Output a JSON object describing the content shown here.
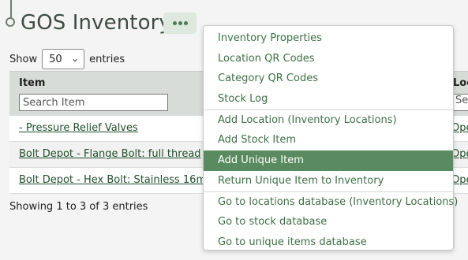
{
  "header": {
    "title": "GOS Inventory"
  },
  "length_control": {
    "show_label": "Show",
    "entries_label": "entries",
    "selected": "50"
  },
  "table": {
    "columns": {
      "item": "Item",
      "location": "Locat"
    },
    "search": {
      "item_placeholder": "Search Item",
      "location_placeholder": "Sear"
    },
    "rows": [
      {
        "item": "- Pressure Relief Valves",
        "location": "Ope"
      },
      {
        "item": "Bolt Depot - Flange Bolt: full thread",
        "location": "Ope"
      },
      {
        "item": "Bolt Depot - Hex Bolt: Stainless 16m",
        "location": "Ope"
      }
    ]
  },
  "info": "Showing 1 to 3 of 3 entries",
  "menu": {
    "groups": [
      [
        "Inventory Properties",
        "Location QR Codes",
        "Category QR Codes",
        "Stock Log"
      ],
      [
        "Add Location (Inventory Locations)",
        "Add Stock Item",
        "Add Unique Item",
        "Return Unique Item to Inventory"
      ],
      [
        "Go to locations database (Inventory Locations)",
        "Go to stock database",
        "Go to unique items database"
      ]
    ],
    "active_item": "Add Unique Item"
  },
  "colors": {
    "accent": "#5a8a60",
    "link": "#1f4f2a",
    "menu_text": "#3d6f46"
  }
}
